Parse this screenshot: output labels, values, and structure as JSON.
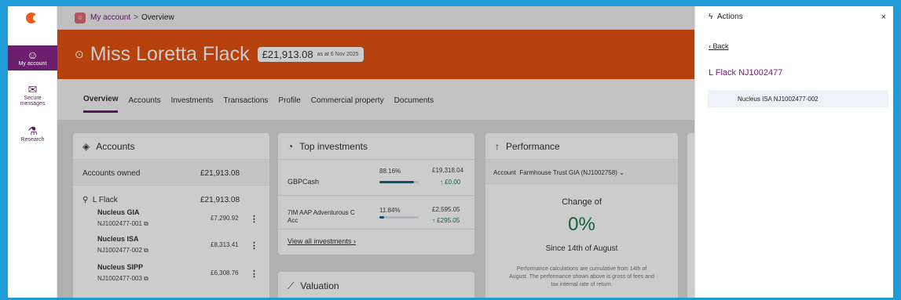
{
  "sidebar": {
    "items": [
      {
        "label": "My account",
        "icon": "account-icon"
      },
      {
        "label": "Secure",
        "label2": "messages",
        "icon": "messages-icon"
      },
      {
        "label": "Research",
        "icon": "research-icon"
      }
    ]
  },
  "breadcrumb": {
    "link": "My account",
    "separator": ">",
    "current": "Overview"
  },
  "hero": {
    "name": "Miss Loretta Flack",
    "balance": "£21,913.08",
    "as_at": "as at 6 Nov 2025",
    "color": "#e5520f"
  },
  "tabs": [
    "Overview",
    "Accounts",
    "Investments",
    "Transactions",
    "Profile",
    "Commercial property",
    "Documents"
  ],
  "accounts": {
    "title": "Accounts",
    "owned_label": "Accounts owned",
    "owned_value": "£21,913.08",
    "holder": "L Flack",
    "holder_value": "£21,913.08",
    "items": [
      {
        "name": "Nucleus GIA",
        "ref": "NJ1002477-001",
        "value": "£7,290.92"
      },
      {
        "name": "Nucleus ISA",
        "ref": "NJ1002477-002",
        "value": "£8,313.41"
      },
      {
        "name": "Nucleus SIPP",
        "ref": "NJ1002477-003",
        "value": "£6,308.76"
      }
    ]
  },
  "top_investments": {
    "title": "Top investments",
    "items": [
      {
        "name": "GBPCash",
        "name2": "",
        "pct": "88.16%",
        "pct_value": 0.8816,
        "value": "£19,318.04",
        "change": "↑ £0.00"
      },
      {
        "name": "7IM AAP Adventurous C",
        "name2": "Acc",
        "pct": "11.84%",
        "pct_value": 0.1184,
        "value": "£2,595.05",
        "change": "↑ £295.05"
      }
    ],
    "view_all": "View all investments"
  },
  "valuation": {
    "title": "Valuation"
  },
  "performance": {
    "title": "Performance",
    "account_label": "Account",
    "account_value": "Farmhouse Trust GIA (NJ1002758)",
    "change_of": "Change of",
    "change_value": "0%",
    "since": "Since 14th of August",
    "note1": "Performance calculations are cumulative from 14th of",
    "note2": "August. The performance shown above is gross of fees and",
    "note3": "tax internal rate of return.",
    "accent": "#1a7a4a"
  },
  "drawer": {
    "title": "Actions",
    "close": "×",
    "back": "Back",
    "account": "L Flack NJ1002477",
    "item": "Nucleus ISA NJ1002477-002"
  }
}
